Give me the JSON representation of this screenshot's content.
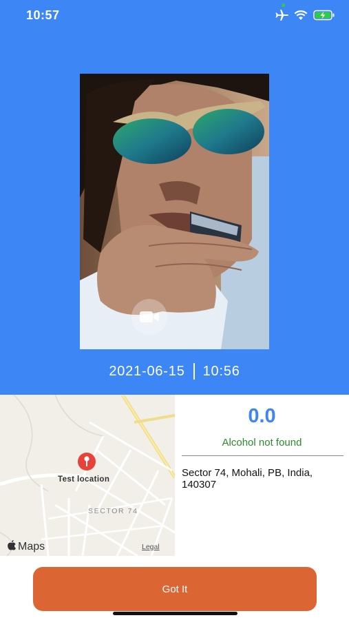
{
  "status_bar": {
    "time": "10:57",
    "icons": [
      "airplane-icon",
      "wifi-icon",
      "battery-charging-icon"
    ]
  },
  "capture": {
    "date": "2021-06-15",
    "time": "10:56",
    "media_icon": "video-camera-icon"
  },
  "map": {
    "pin_label": "Test location",
    "sector_label": "SECTOR 74",
    "brand": "Maps",
    "legal": "Legal"
  },
  "result": {
    "value": "0.0",
    "status": "Alcohol not found",
    "address": "Sector 74, Mohali, PB, India, 140307"
  },
  "actions": {
    "got_it_label": "Got It"
  },
  "colors": {
    "header_blue": "#3d86f6",
    "reading_blue": "#3d86f6",
    "status_green": "#2a8a2a",
    "button_orange": "#dc6534"
  }
}
